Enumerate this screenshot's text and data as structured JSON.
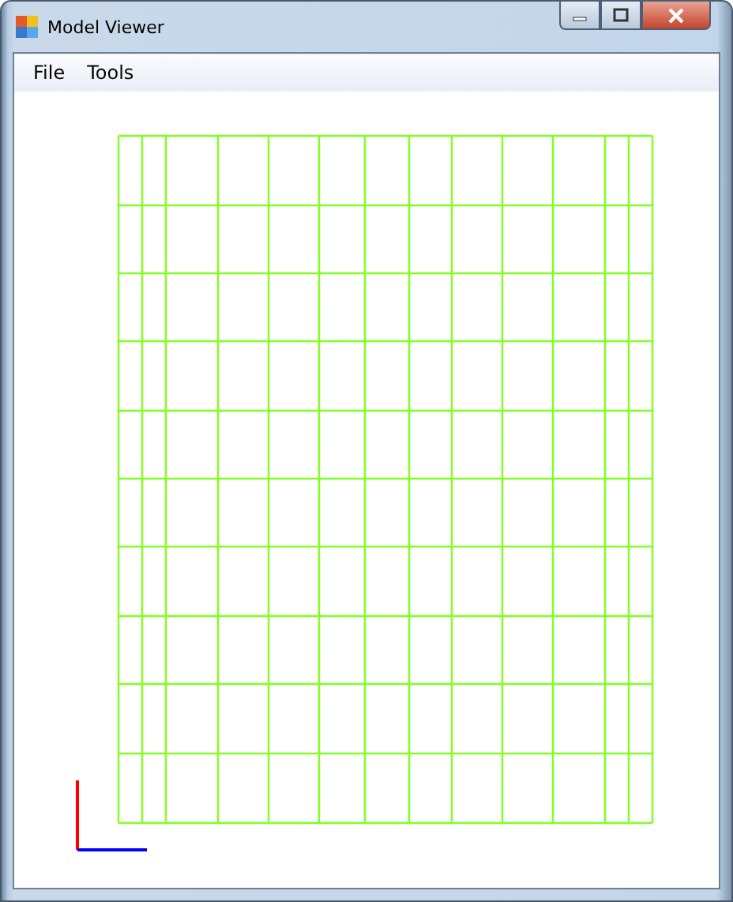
{
  "window": {
    "title": "Model Viewer"
  },
  "menu": [
    {
      "label": "File"
    },
    {
      "label": "Tools"
    }
  ]
}
